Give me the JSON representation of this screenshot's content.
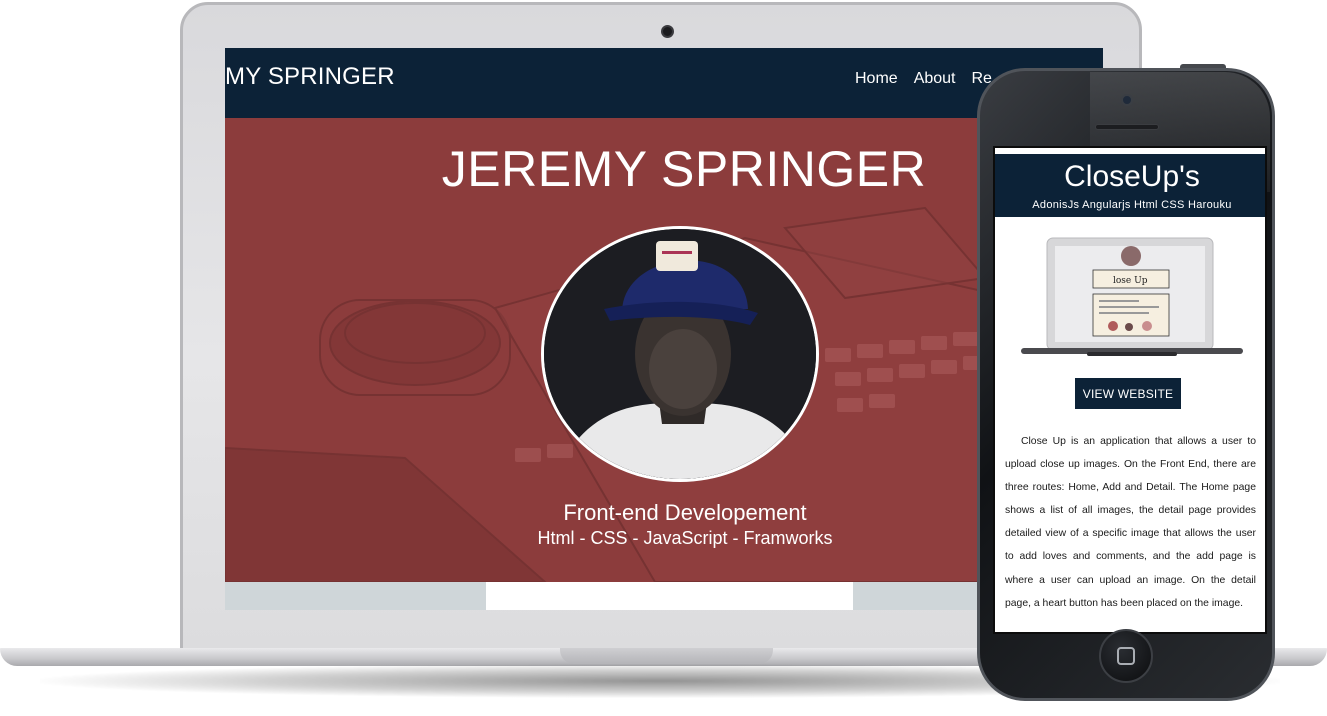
{
  "laptop": {
    "site": {
      "logo": "MY SPRINGER",
      "nav": [
        {
          "label": "Home"
        },
        {
          "label": "About"
        },
        {
          "label": "Re"
        }
      ],
      "hero": {
        "title": "JEREMY SPRINGER",
        "role": "Front-end Developement",
        "skills": "Html - CSS - JavaScript - Framworks"
      }
    }
  },
  "phone": {
    "header": {
      "title": "CloseUp's",
      "subtitle": "AdonisJs Angularjs Html CSS Harouku"
    },
    "mockup_label": "lose Up",
    "cta_label": "VIEW WEBSITE",
    "description": "Close Up is an application that allows a user to upload close up images. On the Front End, there are three routes: Home, Add and Detail. The Home page shows a list of all images, the detail page provides detailed view of a specific image that allows the user to add loves and comments, and the add page is where a user can upload an image. On the detail page, a heart button has been placed on the image."
  },
  "colors": {
    "navy": "#0c2237",
    "hero_red": "#8c3c3c",
    "text_white": "#ffffff"
  }
}
